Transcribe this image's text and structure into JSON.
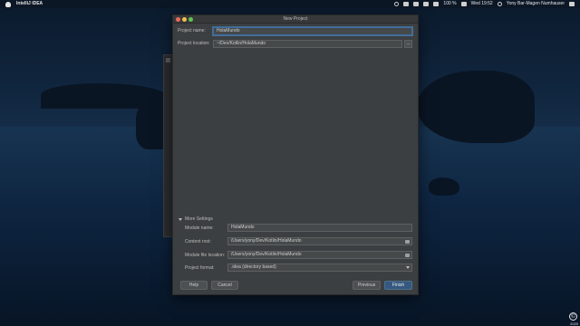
{
  "menubar": {
    "app_name": "IntelliJ IDEA",
    "clock": "Wed 19:52",
    "user": "Yony Bar-Magen Numhauser",
    "battery": "100 %"
  },
  "dialog": {
    "title": "New Project",
    "project_name_label": "Project name:",
    "project_name_value": "HolaMundo",
    "project_location_label": "Project location:",
    "project_location_value": "~/Dev/Kotlin/HolaMundo",
    "browse_label": "...",
    "more_settings_label": "More Settings",
    "module_name_label": "Module name:",
    "module_name_value": "HolaMundo",
    "content_root_label": "Content root:",
    "content_root_value": "/Users/yony/Dev/Kotlin/HolaMundo",
    "module_file_location_label": "Module file location:",
    "module_file_location_value": "/Users/yony/Dev/Kotlin/HolaMundo",
    "project_format_label": "Project format:",
    "project_format_value": ".idea (directory based)",
    "buttons": {
      "help": "Help",
      "cancel": "Cancel",
      "previous": "Previous",
      "finish": "Finish"
    }
  },
  "watermark": {
    "year": "2020"
  }
}
